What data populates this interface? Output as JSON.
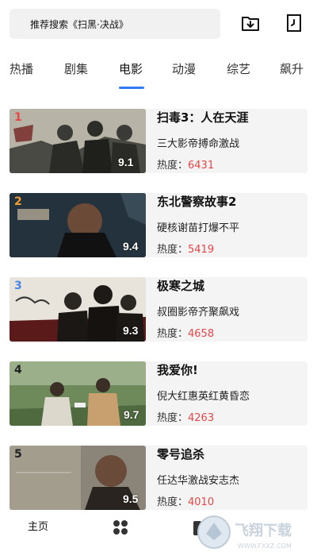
{
  "search": {
    "placeholder": "推荐搜索《扫黑·决战》"
  },
  "header_icons": [
    "download-icon",
    "history-icon"
  ],
  "tabs": [
    {
      "label": "热播",
      "active": false
    },
    {
      "label": "剧集",
      "active": false
    },
    {
      "label": "电影",
      "active": true
    },
    {
      "label": "动漫",
      "active": false
    },
    {
      "label": "综艺",
      "active": false
    },
    {
      "label": "飙升",
      "active": false
    }
  ],
  "colors": {
    "accent": "#2f7bf6",
    "heat_value": "#e84646",
    "rank_1": "#e84646",
    "rank_2": "#f0a030",
    "rank_3": "#4a86e8",
    "rank_other": "#222222"
  },
  "movies": [
    {
      "rank": "1",
      "title": "扫毒3：人在天涯",
      "desc": "三大影帝搏命激战",
      "heat_label": "热度：",
      "heat": "6431",
      "score": "9.1"
    },
    {
      "rank": "2",
      "title": "东北警察故事2",
      "desc": "硬核谢苗打爆不平",
      "heat_label": "热度：",
      "heat": "5419",
      "score": "9.4"
    },
    {
      "rank": "3",
      "title": "极寒之城",
      "desc": "叔圈影帝齐聚飙戏",
      "heat_label": "热度：",
      "heat": "4658",
      "score": "9.3"
    },
    {
      "rank": "4",
      "title": "我爱你!",
      "desc": "倪大红惠英红黄昏恋",
      "heat_label": "热度：",
      "heat": "4263",
      "score": "9.7"
    },
    {
      "rank": "5",
      "title": "零号追杀",
      "desc": "任达华激战安志杰",
      "heat_label": "热度：",
      "heat": "4010",
      "score": "9.5"
    }
  ],
  "bottom_nav": {
    "home_label": "主页"
  },
  "watermark": {
    "text": "飞翔下载",
    "url_text": "WWW.FXXZ.COM"
  }
}
